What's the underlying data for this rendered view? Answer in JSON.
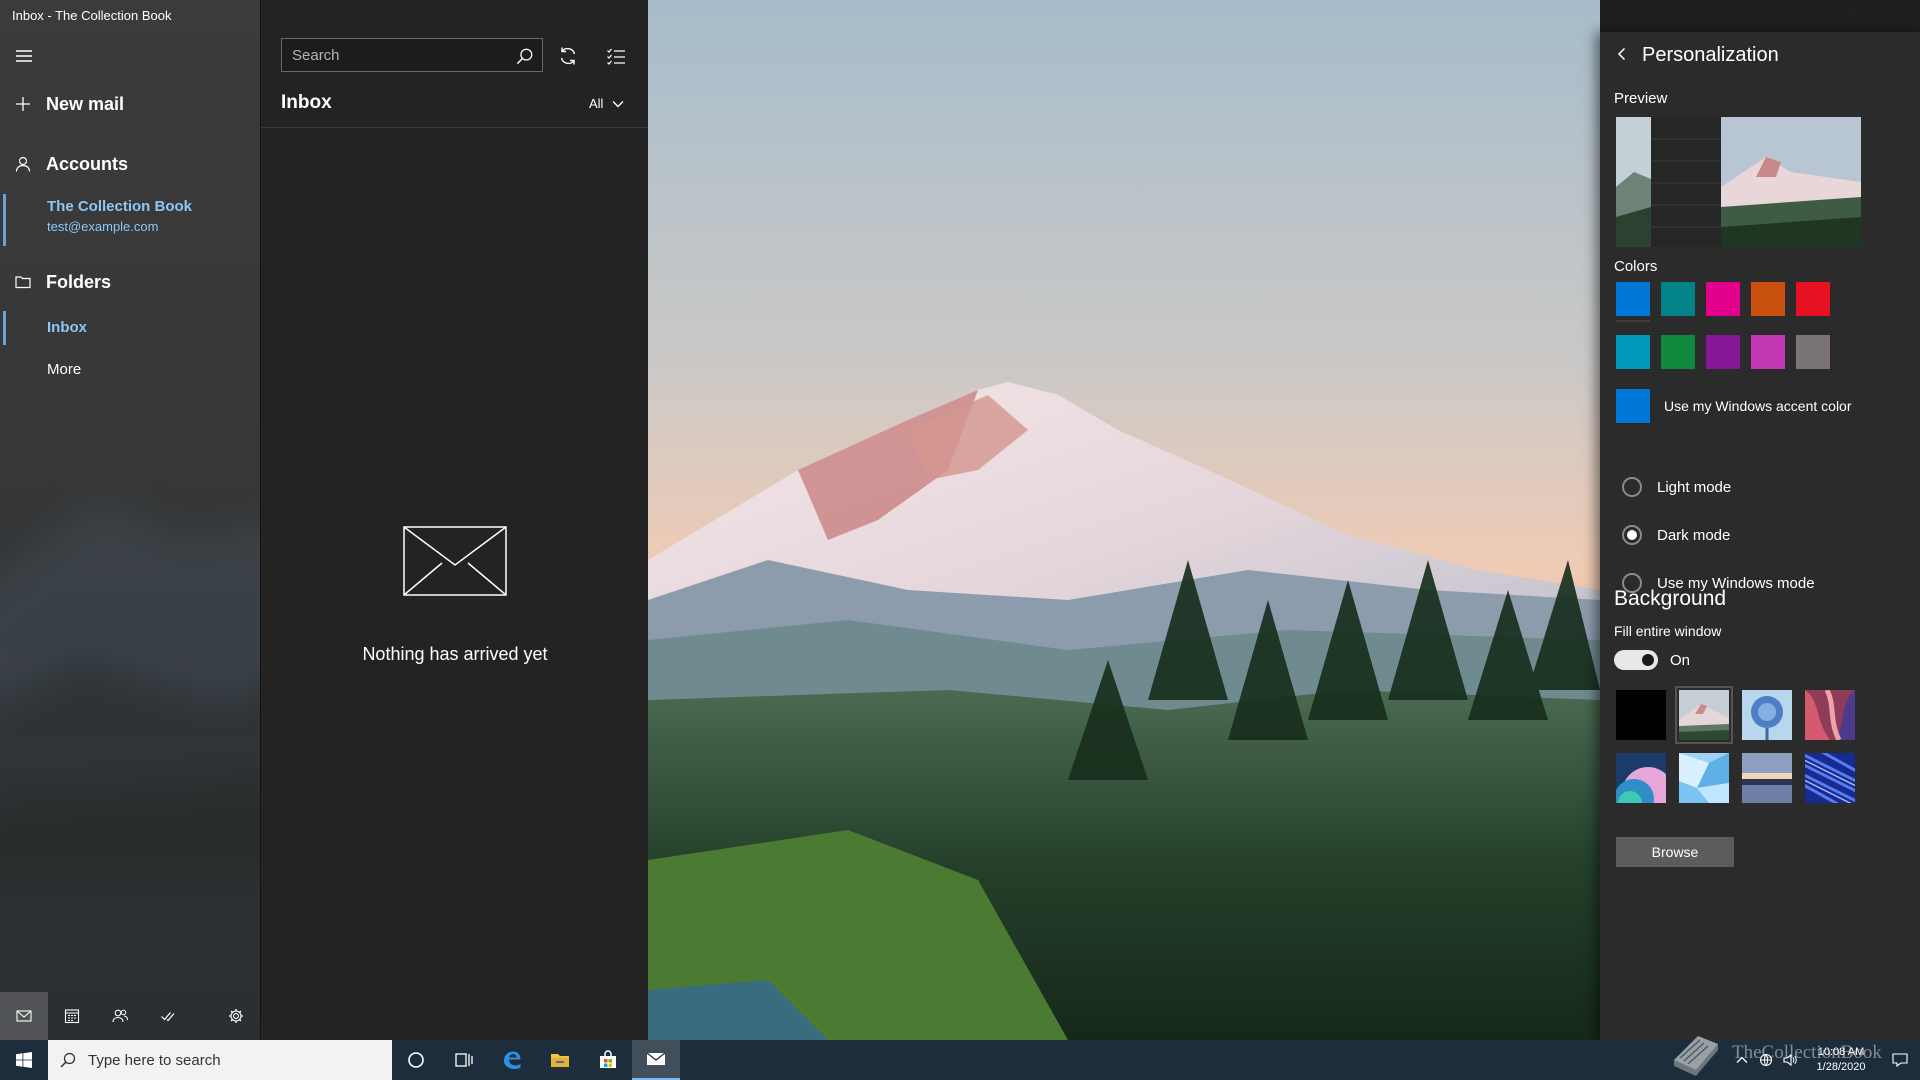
{
  "window": {
    "title": "Inbox - The Collection Book"
  },
  "nav": {
    "new_mail": "New mail",
    "accounts_heading": "Accounts",
    "account": {
      "name": "The Collection Book",
      "email": "test@example.com"
    },
    "folders_heading": "Folders",
    "folders": [
      {
        "label": "Inbox",
        "selected": true
      },
      {
        "label": "More",
        "selected": false
      }
    ],
    "bottom_icons": [
      "mail-icon",
      "calendar-icon",
      "people-icon",
      "todo-icon",
      "settings-icon"
    ]
  },
  "list": {
    "search_placeholder": "Search",
    "heading": "Inbox",
    "filter": "All",
    "empty_message": "Nothing has arrived yet"
  },
  "personalization": {
    "title": "Personalization",
    "preview_label": "Preview",
    "colors_label": "Colors",
    "colors_row1": [
      "#0078d7",
      "#038387",
      "#e3008c",
      "#ca5010",
      "#e81123"
    ],
    "colors_row2": [
      "#0099bc",
      "#10893e",
      "#881798",
      "#c239b3",
      "#7a7574"
    ],
    "selected_color": "#0078d7",
    "accent_label": "Use my Windows accent color",
    "accent_color": "#0078d7",
    "modes": [
      {
        "label": "Light mode",
        "selected": false
      },
      {
        "label": "Dark mode",
        "selected": true
      },
      {
        "label": "Use my Windows mode",
        "selected": false
      }
    ],
    "background_heading": "Background",
    "fill_label": "Fill entire window",
    "fill_state": "On",
    "backgrounds": [
      "solid-black",
      "mountain",
      "blue-flower",
      "red-canyon",
      "abstract-arcs",
      "ice-crystal",
      "sunset-lake",
      "blue-waves"
    ],
    "selected_background": "mountain",
    "browse_label": "Browse"
  },
  "taskbar": {
    "search_placeholder": "Type here to search",
    "time": "10:08 AM",
    "date": "1/28/2020",
    "apps": [
      "cortana-icon",
      "task-view-icon",
      "edge-icon",
      "file-explorer-icon",
      "store-icon",
      "mail-icon"
    ]
  },
  "watermark": {
    "text": "TheCollectionBook"
  }
}
